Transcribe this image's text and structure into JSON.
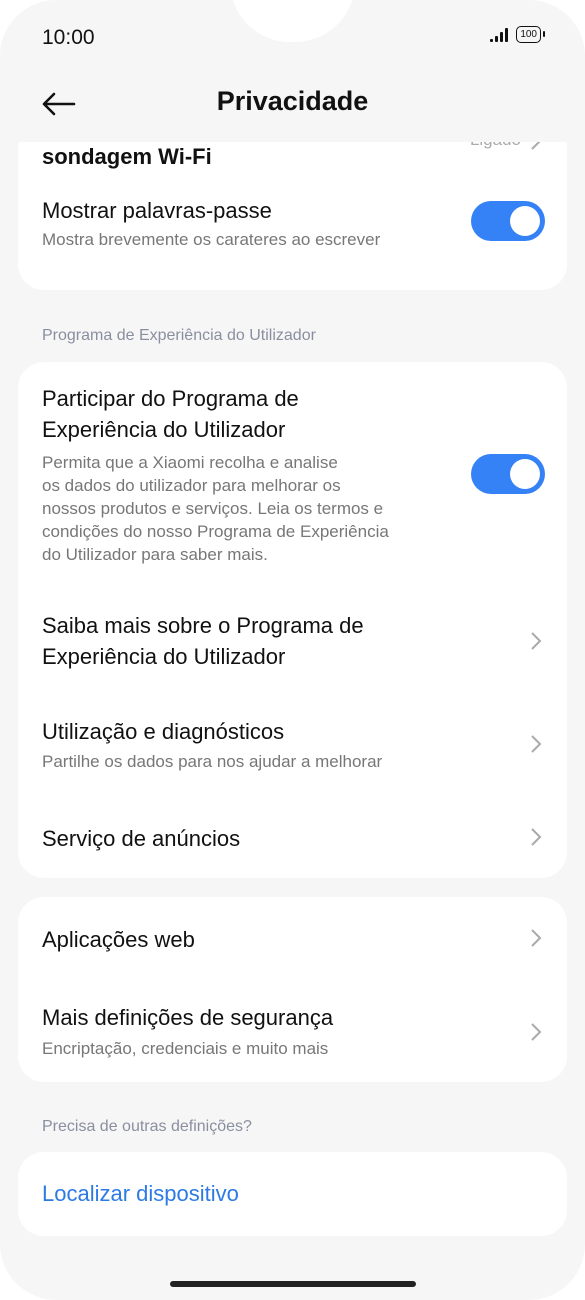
{
  "status": {
    "time": "10:00",
    "battery": "100"
  },
  "header": {
    "title": "Privacidade"
  },
  "top_card": {
    "wifi_title": "sondagem Wi-Fi",
    "wifi_value": "Ligado",
    "pw_title": "Mostrar palavras-passe",
    "pw_desc": "Mostra brevemente os carateres ao escrever",
    "pw_on": true
  },
  "section_ux": "Programa de Experiência do Utilizador",
  "ux_card": {
    "participate_title": [
      "Participar do Programa de",
      "Experiência do Utilizador"
    ],
    "participate_desc": [
      "Permita que a Xiaomi recolha e analise",
      "os dados do utilizador para melhorar os",
      "nossos produtos e serviços. Leia os termos e",
      "condições do nosso Programa de Experiência",
      "do Utilizador para saber mais."
    ],
    "participate_on": true,
    "learn_title": [
      "Saiba mais sobre o Programa de",
      "Experiência do Utilizador"
    ],
    "diag_title": "Utilização e diagnósticos",
    "diag_desc": "Partilhe os dados para nos ajudar a melhorar",
    "ads_title": "Serviço de anúncios"
  },
  "misc_card": {
    "webapps_title": "Aplicações web",
    "security_title": "Mais definições de segurança",
    "security_desc": "Encriptação, credenciais e muito mais"
  },
  "section_other": "Precisa de outras definições?",
  "find_card": {
    "find_title": "Localizar dispositivo"
  },
  "colors": {
    "accent": "#3482f6",
    "link": "#2c7be5",
    "background": "#f6f6f6"
  }
}
